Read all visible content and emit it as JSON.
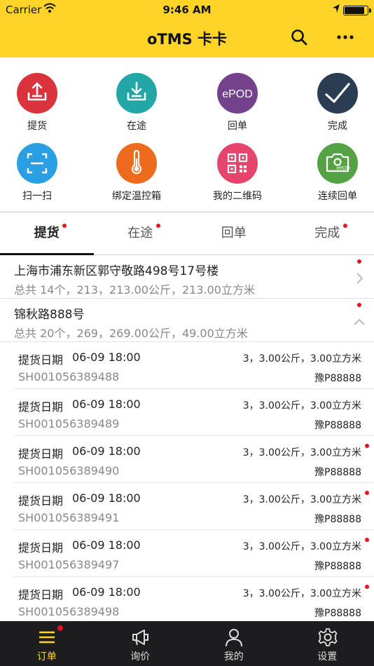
{
  "status_bar": {
    "carrier": "Carrier",
    "time": "9:46 AM",
    "battery_level": 0.9
  },
  "header": {
    "title": "oTMS 卡卡"
  },
  "actions": [
    {
      "label": "提货",
      "icon": "upload-tray-icon",
      "color": "#d9343b"
    },
    {
      "label": "在途",
      "icon": "download-tray-icon",
      "color": "#23a6a6"
    },
    {
      "label": "回单",
      "icon": "epod-icon",
      "color": "#74418c",
      "icon_text": "ePOD"
    },
    {
      "label": "完成",
      "icon": "checkmark-icon",
      "color": "#2a3d52"
    },
    {
      "label": "扫一扫",
      "icon": "scan-icon",
      "color": "#2aa0e2"
    },
    {
      "label": "绑定温控箱",
      "icon": "thermometer-icon",
      "color": "#ec6b1c"
    },
    {
      "label": "我的二维码",
      "icon": "qrcode-icon",
      "color": "#e5446d"
    },
    {
      "label": "连续回单",
      "icon": "camera-epod-icon",
      "color": "#55a244",
      "icon_text": "ePOD"
    }
  ],
  "tabs": [
    {
      "label": "提货",
      "active": true,
      "badge": true
    },
    {
      "label": "在途",
      "active": false,
      "badge": true
    },
    {
      "label": "回单",
      "active": false,
      "badge": false
    },
    {
      "label": "完成",
      "active": false,
      "badge": true
    }
  ],
  "groups": [
    {
      "address": "上海市浦东新区郭守敬路498号17号楼",
      "summary": "总共 14个，213，213.00公斤，213.00立方米",
      "expanded": false,
      "badge": true
    },
    {
      "address": "锦秋路888号",
      "summary": "总共 20个，269，269.00公斤，49.00立方米",
      "expanded": true,
      "badge": true
    }
  ],
  "orders": [
    {
      "date_label": "提货日期",
      "date": "06-09 18:00",
      "qty": "3，3.00公斤，3.00立方米",
      "code": "SH001056389488",
      "plate": "豫P88888",
      "badge": false
    },
    {
      "date_label": "提货日期",
      "date": "06-09 18:00",
      "qty": "3，3.00公斤，3.00立方米",
      "code": "SH001056389489",
      "plate": "豫P88888",
      "badge": false
    },
    {
      "date_label": "提货日期",
      "date": "06-09 18:00",
      "qty": "3，3.00公斤，3.00立方米",
      "code": "SH001056389490",
      "plate": "豫P88888",
      "badge": true
    },
    {
      "date_label": "提货日期",
      "date": "06-09 18:00",
      "qty": "3，3.00公斤，3.00立方米",
      "code": "SH001056389491",
      "plate": "豫P88888",
      "badge": true
    },
    {
      "date_label": "提货日期",
      "date": "06-09 18:00",
      "qty": "3，3.00公斤，3.00立方米",
      "code": "SH001056389497",
      "plate": "豫P88888",
      "badge": true
    },
    {
      "date_label": "提货日期",
      "date": "06-09 18:00",
      "qty": "3，3.00公斤，3.00立方米",
      "code": "SH001056389498",
      "plate": "豫P88888",
      "badge": true
    }
  ],
  "tabbar": [
    {
      "label": "订单",
      "icon": "list-icon",
      "active": true,
      "badge": true
    },
    {
      "label": "询价",
      "icon": "megaphone-icon",
      "active": false,
      "badge": false
    },
    {
      "label": "我的",
      "icon": "user-icon",
      "active": false,
      "badge": false
    },
    {
      "label": "设置",
      "icon": "gear-icon",
      "active": false,
      "badge": false
    }
  ],
  "colors": {
    "brand_yellow": "#ffd426",
    "badge_red": "#e6141e",
    "tabbar_bg": "#1d1d1f"
  }
}
